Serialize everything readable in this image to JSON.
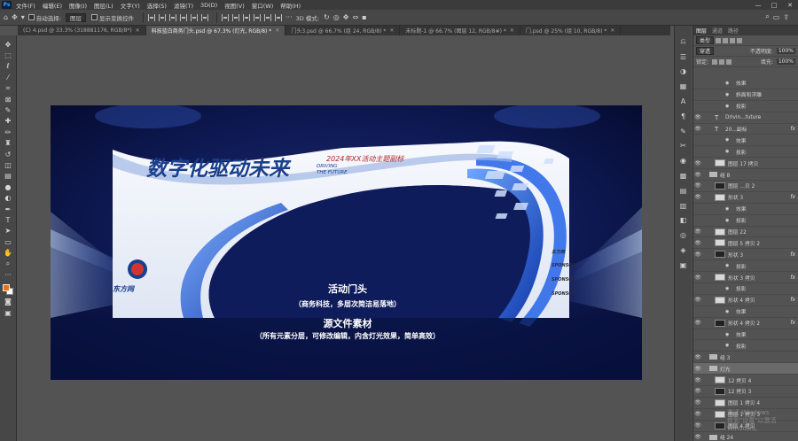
{
  "menu": [
    "文件(F)",
    "编辑(E)",
    "图像(I)",
    "图层(L)",
    "文字(Y)",
    "选择(S)",
    "滤镜(T)",
    "3D(D)",
    "视图(V)",
    "窗口(W)",
    "帮助(H)"
  ],
  "app_logo": "Ps",
  "window_controls": [
    "—",
    "□",
    "✕"
  ],
  "options": {
    "auto_select_label": "自动选择:",
    "auto_select_value": "图层",
    "show_transform_label": "显示变换控件",
    "mode_3d_label": "3D 模式:"
  },
  "tabs": [
    {
      "label": "(C) 4.psd @ 33.3% (318881176, RGB/8*)",
      "active": false
    },
    {
      "label": "科技蓝白商务门头.psd @ 67.3% (灯光, RGB/8) *",
      "active": true
    },
    {
      "label": "门头3.psd @ 66.7% (组 24, RGB/8) *",
      "active": false
    },
    {
      "label": "未标题-1 @ 66.7% (图层 12, RGB/8#) *",
      "active": false
    },
    {
      "label": "门.psd @ 25% (组 10, RGB/8) *",
      "active": false
    }
  ],
  "canvas": {
    "headline": "数字化驱动未来",
    "subtitle": "2024年XX活动主题副标",
    "tagline_1": "DRIVING",
    "tagline_2": "THE FUTURE",
    "logo_text": "东方网",
    "overlay_line1": "活动门头",
    "overlay_line2": "（商务科技，多层次简洁易落地）",
    "overlay_line3": "源文件素材",
    "overlay_line4": "（所有元素分层，可修改编辑，内含灯光效果，简单高效）",
    "sponsors": [
      "东方网",
      "SPONSOR",
      "SPONSOR",
      "SPONSOR"
    ]
  },
  "layers_panel": {
    "tabs": [
      "图层",
      "通道",
      "路径"
    ],
    "kind_select": "类型",
    "blend_select": "穿透",
    "opacity_label": "不透明度:",
    "opacity_value": "100%",
    "lock_label": "锁定:",
    "fill_label": "填充:",
    "fill_value": "100%",
    "items": [
      {
        "name": "效果",
        "type": "effect"
      },
      {
        "name": "斜面和浮雕",
        "type": "effect"
      },
      {
        "name": "投影",
        "type": "effect"
      },
      {
        "name": "Drivin...future",
        "type": "text"
      },
      {
        "name": "20...副标",
        "type": "text",
        "fx": "fx"
      },
      {
        "name": "效果",
        "type": "effect"
      },
      {
        "name": "投影",
        "type": "effect"
      },
      {
        "name": "图层 17 拷贝",
        "type": "layer"
      },
      {
        "name": "组 8",
        "type": "group"
      },
      {
        "name": "图层 ...贝 2",
        "type": "layer"
      },
      {
        "name": "形状 3",
        "type": "layer",
        "fx": "fx"
      },
      {
        "name": "效果",
        "type": "effect"
      },
      {
        "name": "投影",
        "type": "effect"
      },
      {
        "name": "图层 22",
        "type": "layer"
      },
      {
        "name": "图层 5 拷贝 2",
        "type": "layer"
      },
      {
        "name": "形状 3",
        "type": "layer",
        "fx": "fx"
      },
      {
        "name": "投影",
        "type": "effect"
      },
      {
        "name": "形状 3 拷贝",
        "type": "layer",
        "fx": "fx"
      },
      {
        "name": "投影",
        "type": "effect"
      },
      {
        "name": "形状 4 拷贝",
        "type": "layer",
        "fx": "fx"
      },
      {
        "name": "效果",
        "type": "effect"
      },
      {
        "name": "形状 4 拷贝 2",
        "type": "layer",
        "fx": "fx"
      },
      {
        "name": "效果",
        "type": "effect"
      },
      {
        "name": "投影",
        "type": "effect"
      },
      {
        "name": "组 3",
        "type": "group"
      },
      {
        "name": "灯光",
        "type": "group",
        "selected": true
      },
      {
        "name": "12 拷贝 4",
        "type": "layer"
      },
      {
        "name": "12 拷贝 3",
        "type": "layer"
      },
      {
        "name": "图层 1 拷贝 4",
        "type": "layer"
      },
      {
        "name": "图层 1 拷贝 3",
        "type": "layer"
      },
      {
        "name": "图层 4 拷贝",
        "type": "layer"
      },
      {
        "name": "组 24",
        "type": "group"
      }
    ]
  },
  "watermark_line1": "激活 Windows",
  "watermark_line2": "转到\"设置\"以激活 Windows。"
}
